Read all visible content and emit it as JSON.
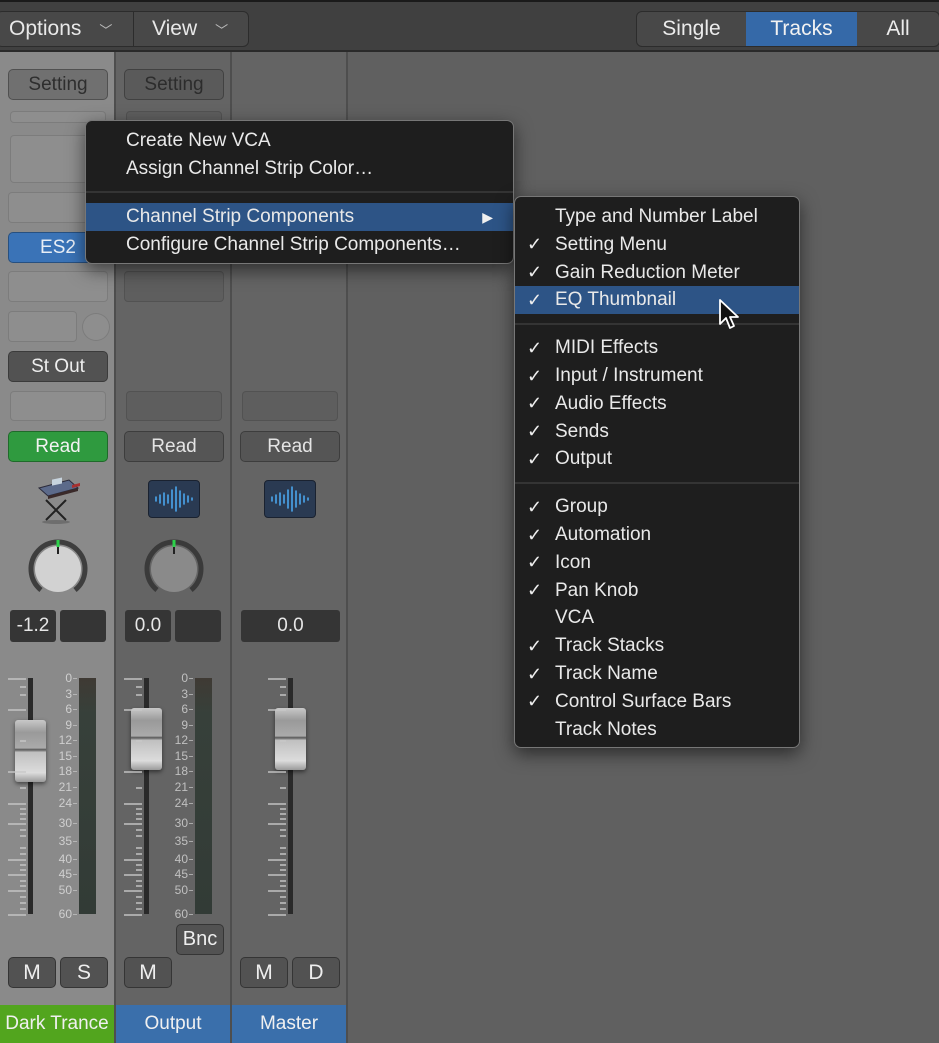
{
  "toolbar": {
    "options_label": "Options",
    "view_label": "View",
    "chevron": "⌄",
    "view_modes": [
      {
        "label": "Single",
        "active": false
      },
      {
        "label": "Tracks",
        "active": true
      },
      {
        "label": "All",
        "active": false
      }
    ]
  },
  "strips": [
    {
      "setting_label": "Setting",
      "instrument_label": "ES2",
      "output_label": "St Out",
      "automation_label": "Read",
      "automation_active": true,
      "icon": "synth-keyboard-icon",
      "volume_value": "-1.2",
      "pan_value": "",
      "buttons": [
        "M",
        "S"
      ],
      "name": "Dark Trance",
      "color": "#52a51e"
    },
    {
      "setting_label": "Setting",
      "automation_label": "Read",
      "automation_active": false,
      "icon": "waveform-icon",
      "volume_value": "0.0",
      "pan_value": "",
      "bounce_label": "Bnc",
      "buttons": [
        "M"
      ],
      "name": "Output",
      "color": "#3a6fab"
    },
    {
      "automation_label": "Read",
      "automation_active": false,
      "icon": "waveform-icon",
      "volume_value": "0.0",
      "buttons": [
        "M",
        "D"
      ],
      "name": "Master",
      "color": "#3a6fab"
    }
  ],
  "meter_scale": [
    "0",
    "3",
    "6",
    "9",
    "12",
    "15",
    "18",
    "21",
    "24",
    "30",
    "35",
    "40",
    "45",
    "50",
    "60"
  ],
  "context_menu": {
    "items": [
      {
        "label": "Create New VCA"
      },
      {
        "label": "Assign Channel Strip Color…"
      },
      {
        "label": "Channel Strip Components",
        "submenu": true,
        "highlighted": true,
        "arrow": "▶"
      },
      {
        "label": "Configure Channel Strip Components…"
      }
    ]
  },
  "submenu": {
    "check_glyph": "✓",
    "groups": [
      [
        {
          "label": "Type and Number Label",
          "checked": false
        },
        {
          "label": "Setting Menu",
          "checked": true
        },
        {
          "label": "Gain Reduction Meter",
          "checked": true
        },
        {
          "label": "EQ Thumbnail",
          "checked": true,
          "highlighted": true
        }
      ],
      [
        {
          "label": "MIDI Effects",
          "checked": true
        },
        {
          "label": "Input / Instrument",
          "checked": true
        },
        {
          "label": "Audio Effects",
          "checked": true
        },
        {
          "label": "Sends",
          "checked": true
        },
        {
          "label": "Output",
          "checked": true
        }
      ],
      [
        {
          "label": "Group",
          "checked": true
        },
        {
          "label": "Automation",
          "checked": true
        },
        {
          "label": "Icon",
          "checked": true
        },
        {
          "label": "Pan Knob",
          "checked": true
        },
        {
          "label": "VCA",
          "checked": false
        },
        {
          "label": "Track Stacks",
          "checked": true
        },
        {
          "label": "Track Name",
          "checked": true
        },
        {
          "label": "Control Surface Bars",
          "checked": true
        },
        {
          "label": "Track Notes",
          "checked": false
        }
      ]
    ]
  }
}
